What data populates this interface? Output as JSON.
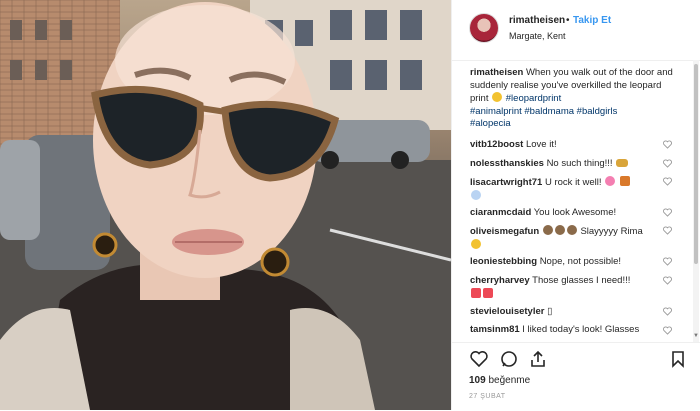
{
  "post": {
    "username": "rimatheisen",
    "separator": "•",
    "follow_label": "Takip Et",
    "location": "Margate, Kent"
  },
  "caption": {
    "username": "rimatheisen",
    "text": "When you walk out of the door and suddenly realise you've overkilled the leopard print",
    "hashtags_line1": "#leopardprint",
    "hashtags_line2": "#animalprint #baldmama #baldgirls",
    "hashtags_line3": "#alopecia"
  },
  "comments": [
    {
      "user": "vitb12boost",
      "text": "Love it!"
    },
    {
      "user": "nolessthanskies",
      "text": "No such thing!!!"
    },
    {
      "user": "lisacartwright71",
      "text": "U rock it well!"
    },
    {
      "user": "ciaranmcdaid",
      "text": "You look Awesome!"
    },
    {
      "user": "oliveismegafun",
      "text": "Slayyyyy Rima"
    },
    {
      "user": "leoniestebbing",
      "text": "Nope, not possible!"
    },
    {
      "user": "cherryharvey",
      "text": "Those glasses I need!!!"
    },
    {
      "user": "stevielouisetyler",
      "text": "▯"
    },
    {
      "user": "tamsinm81",
      "text": "I liked today's look! Glasses"
    }
  ],
  "icons": {
    "like": "heart-outline-icon",
    "comment": "comment-bubble-icon",
    "share": "share-arrow-icon",
    "save": "bookmark-icon"
  },
  "likes": {
    "count": "109",
    "label": "beğenme"
  },
  "date": "27 ŞUBAT",
  "colors": {
    "link": "#3897f0",
    "hashtag": "#003569",
    "heart_red": "#ed4956"
  }
}
